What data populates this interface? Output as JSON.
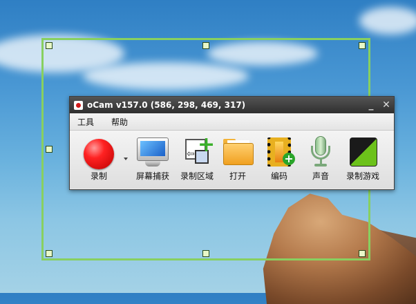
{
  "window": {
    "title": "oCam v157.0 (586, 298, 469, 317)",
    "minimize_label": "_",
    "close_label": "✕"
  },
  "menu": {
    "items": [
      "工具",
      "帮助"
    ]
  },
  "toolbar": {
    "record_label": "录制",
    "screen_capture_label": "屏幕捕获",
    "record_region_label": "录制区域",
    "open_label": "打开",
    "codec_label": "编码",
    "sound_label": "声音",
    "game_record_label": "录制游戏"
  },
  "colors": {
    "selection_border": "#88d060",
    "record_button": "#ee2222",
    "titlebar": "#3a3a3a"
  }
}
